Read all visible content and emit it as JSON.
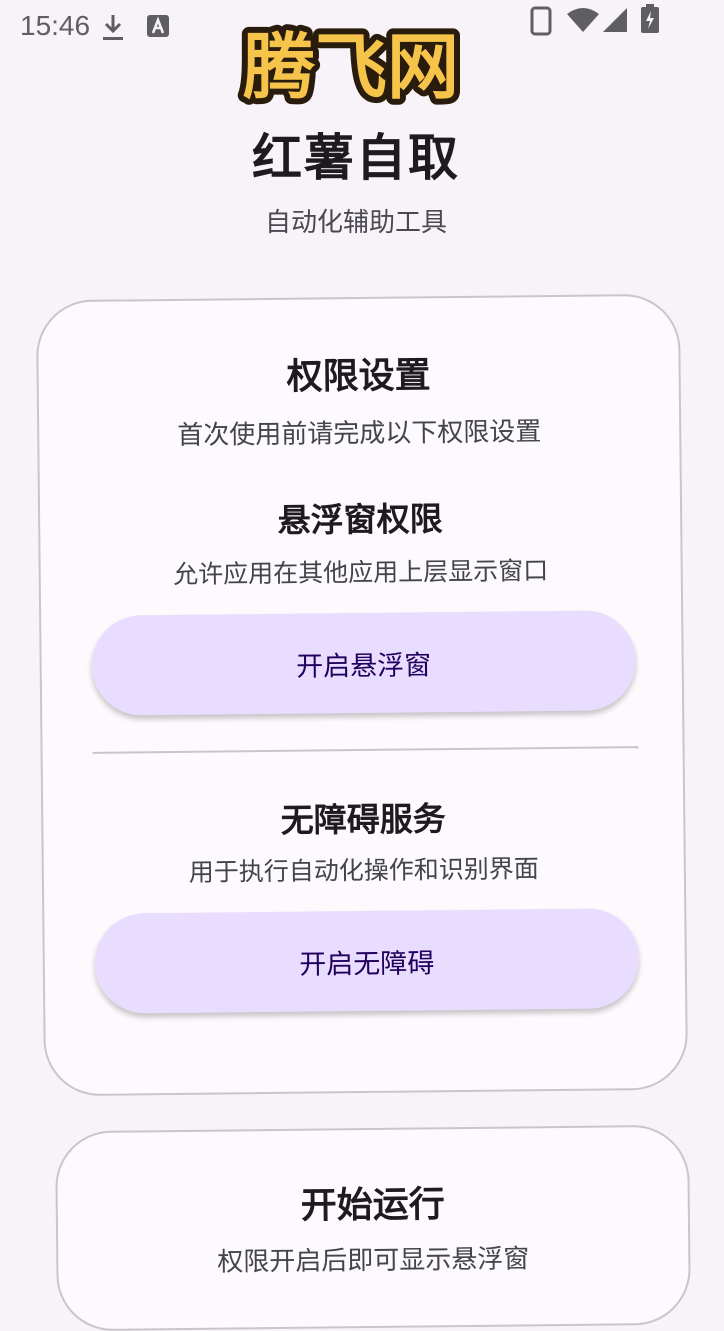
{
  "status_bar": {
    "time": "15:46",
    "icons": [
      "download-icon",
      "a-notification-icon",
      "phone-icon",
      "wifi-icon",
      "signal-icon",
      "battery-charging-icon"
    ]
  },
  "watermark": {
    "text": "腾飞网"
  },
  "header": {
    "title": "红薯自取",
    "subtitle": "自动化辅助工具"
  },
  "permissions_card": {
    "title": "权限设置",
    "description": "首次使用前请完成以下权限设置",
    "overlay": {
      "title": "悬浮窗权限",
      "description": "允许应用在其他应用上层显示窗口",
      "button_label": "开启悬浮窗"
    },
    "accessibility": {
      "title": "无障碍服务",
      "description": "用于执行自动化操作和识别界面",
      "button_label": "开启无障碍"
    }
  },
  "run_card": {
    "title": "开始运行",
    "description": "权限开启后即可显示悬浮窗"
  },
  "colors": {
    "background": "#f7f3f8",
    "button_fill": "#e9ddff",
    "button_text": "#21005d",
    "card_border": "#c9c5cc"
  }
}
